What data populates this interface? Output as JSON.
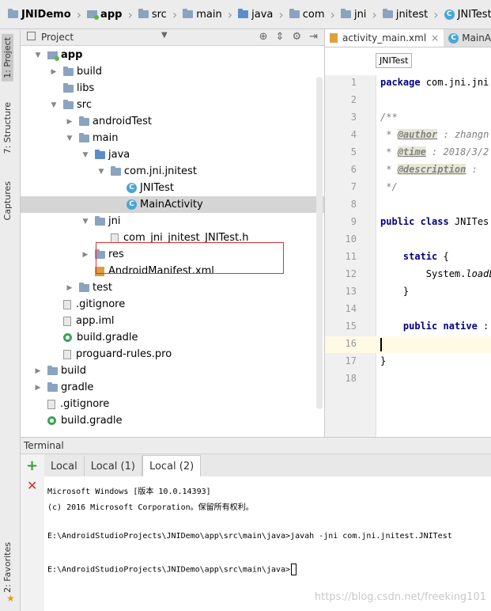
{
  "breadcrumb": [
    "JNIDemo",
    "app",
    "src",
    "main",
    "java",
    "com",
    "jni",
    "jnitest",
    "JNITest"
  ],
  "left_strip": {
    "project_tab": "1: Project",
    "structure_tab": "7: Structure",
    "captures_tab": "Captures",
    "favorites_tab": "2: Favorites"
  },
  "project_panel": {
    "title": "Project",
    "tree": [
      {
        "label": "app",
        "depth": 1,
        "arrow": "down",
        "icon": "module",
        "bold": true
      },
      {
        "label": "build",
        "depth": 2,
        "arrow": "right",
        "icon": "folder"
      },
      {
        "label": "libs",
        "depth": 2,
        "arrow": "",
        "icon": "folder"
      },
      {
        "label": "src",
        "depth": 2,
        "arrow": "down",
        "icon": "folder"
      },
      {
        "label": "androidTest",
        "depth": 3,
        "arrow": "right",
        "icon": "folder"
      },
      {
        "label": "main",
        "depth": 3,
        "arrow": "down",
        "icon": "folder"
      },
      {
        "label": "java",
        "depth": 4,
        "arrow": "down",
        "icon": "folder-blue"
      },
      {
        "label": "com.jni.jnitest",
        "depth": 5,
        "arrow": "down",
        "icon": "package"
      },
      {
        "label": "JNITest",
        "depth": 6,
        "arrow": "",
        "icon": "class"
      },
      {
        "label": "MainActivity",
        "depth": 6,
        "arrow": "",
        "icon": "class",
        "selected": true
      },
      {
        "label": "jni",
        "depth": 4,
        "arrow": "down",
        "icon": "folder"
      },
      {
        "label": "com_jni_jnitest_JNITest.h",
        "depth": 5,
        "arrow": "",
        "icon": "file"
      },
      {
        "label": "res",
        "depth": 4,
        "arrow": "right",
        "icon": "folder"
      },
      {
        "label": "AndroidManifest.xml",
        "depth": 4,
        "arrow": "",
        "icon": "manifest"
      },
      {
        "label": "test",
        "depth": 3,
        "arrow": "right",
        "icon": "folder"
      },
      {
        "label": ".gitignore",
        "depth": 2,
        "arrow": "",
        "icon": "file"
      },
      {
        "label": "app.iml",
        "depth": 2,
        "arrow": "",
        "icon": "file"
      },
      {
        "label": "build.gradle",
        "depth": 2,
        "arrow": "",
        "icon": "gradle"
      },
      {
        "label": "proguard-rules.pro",
        "depth": 2,
        "arrow": "",
        "icon": "file"
      },
      {
        "label": "build",
        "depth": 1,
        "arrow": "right",
        "icon": "folder"
      },
      {
        "label": "gradle",
        "depth": 1,
        "arrow": "right",
        "icon": "folder"
      },
      {
        "label": ".gitignore",
        "depth": 1,
        "arrow": "",
        "icon": "file"
      },
      {
        "label": "build.gradle",
        "depth": 1,
        "arrow": "",
        "icon": "gradle"
      }
    ]
  },
  "editor": {
    "tabs": [
      "activity_main.xml",
      "MainA"
    ],
    "tooltip": "JNITest",
    "lines": [
      {
        "n": "1",
        "html": "<span class=\"kw\">package</span> com.jni.jni"
      },
      {
        "n": "2",
        "html": ""
      },
      {
        "n": "3",
        "html": "<span class=\"cm\">/**</span>"
      },
      {
        "n": "4",
        "html": "<span class=\"cm\"> * </span><span class=\"tag\">@author</span><span class=\"cm\"> : zhangn</span>"
      },
      {
        "n": "5",
        "html": "<span class=\"cm\"> * </span><span class=\"tag\">@time</span><span class=\"cm\"> : 2018/3/2</span>"
      },
      {
        "n": "6",
        "html": "<span class=\"cm\"> * </span><span class=\"tag\">@description</span><span class=\"cm\"> :</span>"
      },
      {
        "n": "7",
        "html": "<span class=\"cm\"> */</span>"
      },
      {
        "n": "8",
        "html": ""
      },
      {
        "n": "9",
        "html": "<span class=\"kw\">public class</span> JNITes"
      },
      {
        "n": "10",
        "html": ""
      },
      {
        "n": "11",
        "html": "    <span class=\"kw\">static</span> {"
      },
      {
        "n": "12",
        "html": "        System.<i>loadL</i>"
      },
      {
        "n": "13",
        "html": "    }"
      },
      {
        "n": "14",
        "html": ""
      },
      {
        "n": "15",
        "html": "    <span class=\"kw\">public native</span> :"
      },
      {
        "n": "16",
        "html": ""
      },
      {
        "n": "17",
        "html": "}"
      },
      {
        "n": "18",
        "html": ""
      }
    ]
  },
  "terminal": {
    "title": "Terminal",
    "tabs": [
      "Local",
      "Local (1)",
      "Local (2)"
    ],
    "active_tab": 2,
    "lines": [
      "Microsoft Windows [版本 10.0.14393]",
      "(c) 2016 Microsoft Corporation。保留所有权利。",
      "",
      "E:\\AndroidStudioProjects\\JNIDemo\\app\\src\\main\\java>javah -jni com.jni.jnitest.JNITest",
      "",
      "E:\\AndroidStudioProjects\\JNIDemo\\app\\src\\main\\java>"
    ]
  },
  "watermark": "https://blog.csdn.net/freeking101"
}
